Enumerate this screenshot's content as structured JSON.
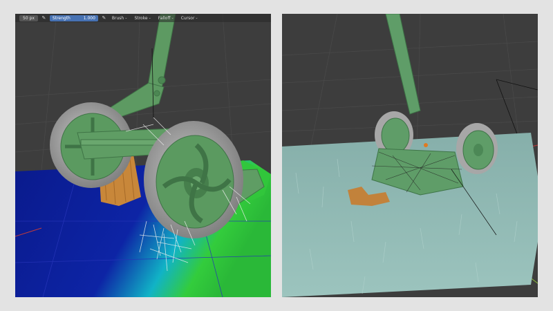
{
  "left_viewport": {
    "toolbar": {
      "radius_value": "50 px",
      "radius_icon": "pen-pressure-icon",
      "strength_label": "Strength",
      "strength_value": "1.000",
      "strength_icon": "pen-pressure-icon",
      "menus": [
        {
          "label": "Brush",
          "icon": "chevron-down-icon"
        },
        {
          "label": "Stroke",
          "icon": "chevron-down-icon"
        },
        {
          "label": "Falloff",
          "icon": "chevron-down-icon"
        },
        {
          "label": "Cursor",
          "icon": "chevron-down-icon"
        }
      ]
    },
    "colors": {
      "viewport_bg": "#3d3d3d",
      "weight_low": "#0a1a8c",
      "weight_high": "#2fc93a",
      "mower_green": "#5d9a62",
      "tire_gray": "#a9a9a9",
      "wood_orange": "#c8873a"
    }
  },
  "right_viewport": {
    "colors": {
      "viewport_bg": "#3d3d3d",
      "grass": "#8fb8b2",
      "mower_green": "#5f9d68",
      "wood_orange": "#c2823b"
    }
  }
}
